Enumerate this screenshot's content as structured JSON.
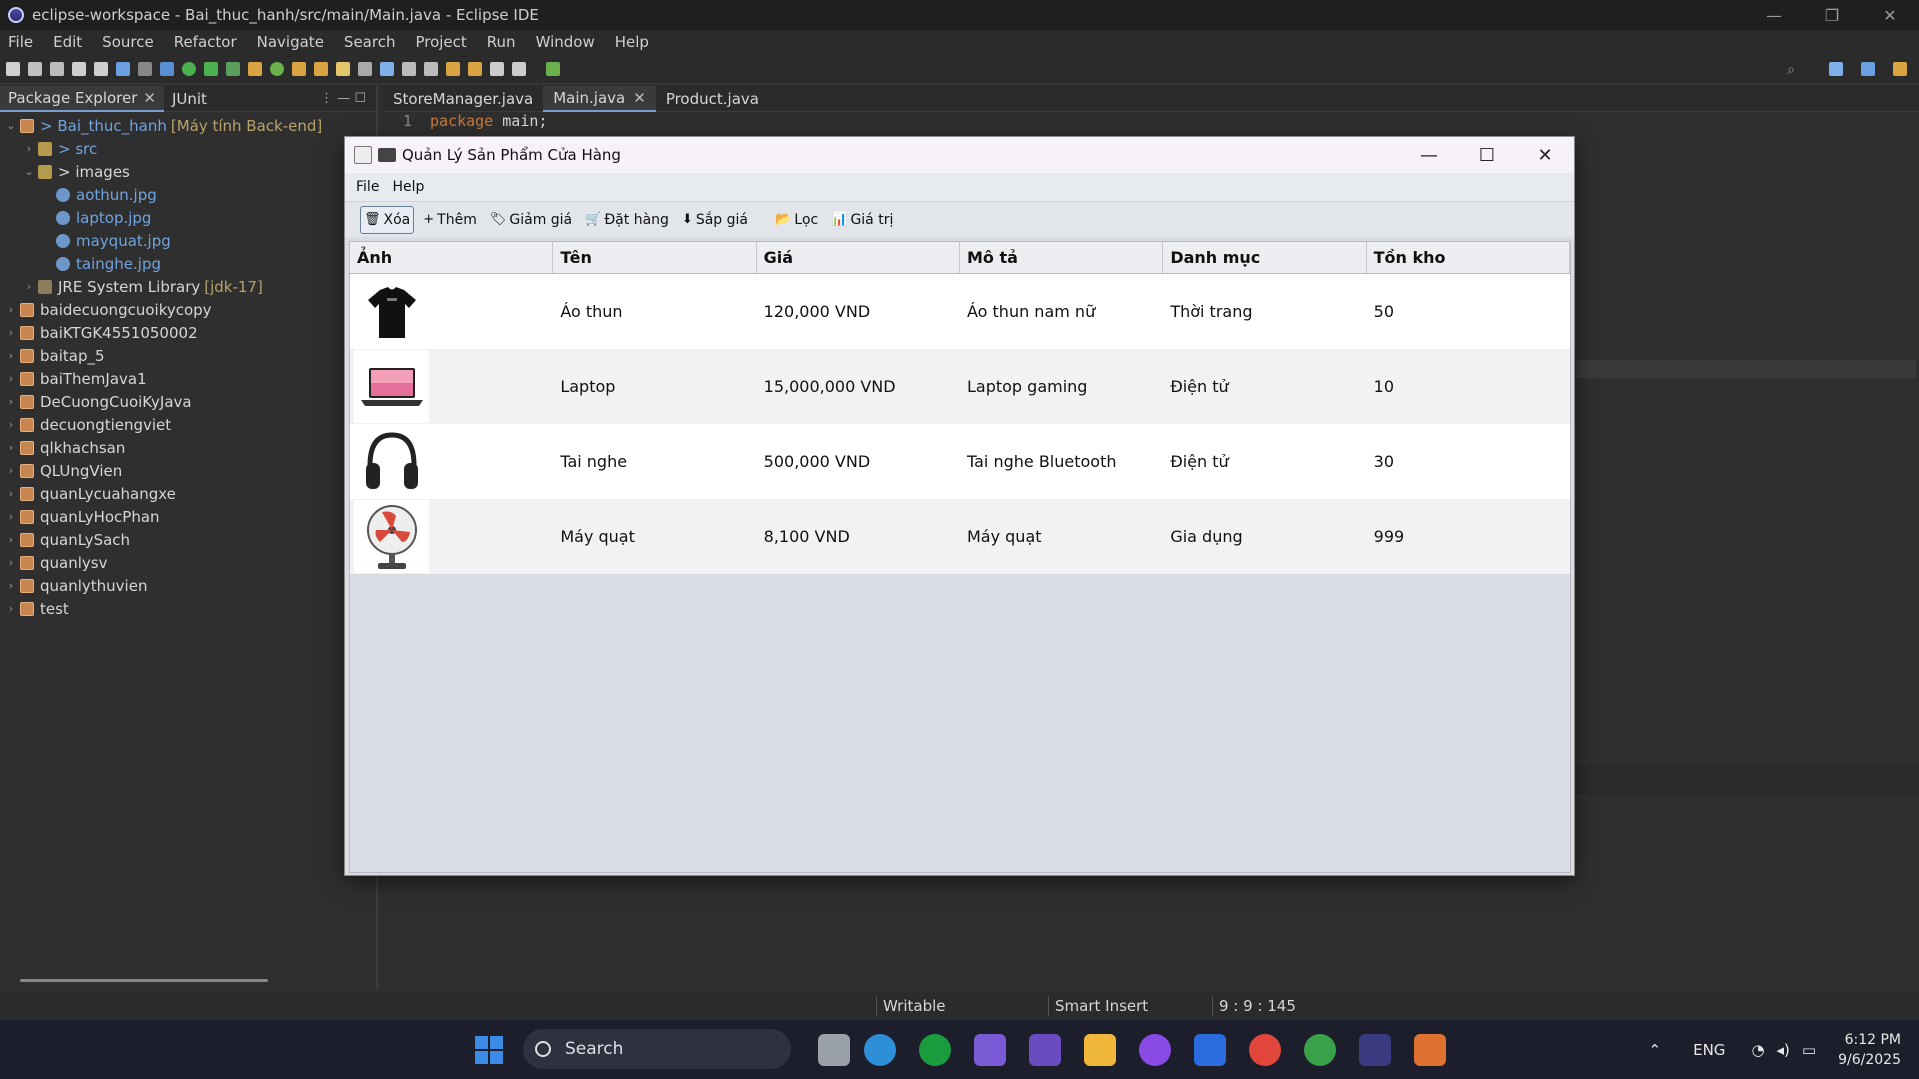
{
  "ide": {
    "title": "eclipse-workspace - Bai_thuc_hanh/src/main/Main.java - Eclipse IDE",
    "menu": [
      "File",
      "Edit",
      "Source",
      "Refactor",
      "Navigate",
      "Search",
      "Project",
      "Run",
      "Window",
      "Help"
    ],
    "explorer_tabs": [
      {
        "label": "Package Explorer",
        "active": true
      },
      {
        "label": "JUnit",
        "active": false
      }
    ],
    "tree": [
      {
        "arrow": "⌄",
        "indent": 0,
        "icon": "project-icon",
        "label": "> Bai_thuc_hanh",
        "suffix": "[Máy tính Back-end]",
        "style": "link"
      },
      {
        "arrow": "›",
        "indent": 1,
        "icon": "folder-icon",
        "label": "> src",
        "suffix": "",
        "style": "link"
      },
      {
        "arrow": "⌄",
        "indent": 1,
        "icon": "folder-icon",
        "label": "> images",
        "suffix": "",
        "style": ""
      },
      {
        "arrow": "",
        "indent": 2,
        "icon": "file-icon",
        "label": "aothun.jpg",
        "suffix": "",
        "style": "link"
      },
      {
        "arrow": "",
        "indent": 2,
        "icon": "file-icon",
        "label": "laptop.jpg",
        "suffix": "",
        "style": "link"
      },
      {
        "arrow": "",
        "indent": 2,
        "icon": "file-icon",
        "label": "mayquat.jpg",
        "suffix": "",
        "style": "link"
      },
      {
        "arrow": "",
        "indent": 2,
        "icon": "file-icon",
        "label": "tainghe.jpg",
        "suffix": "",
        "style": "link"
      },
      {
        "arrow": "›",
        "indent": 1,
        "icon": "library-icon",
        "label": "JRE System Library",
        "suffix": "[jdk-17]",
        "style": ""
      },
      {
        "arrow": "›",
        "indent": 0,
        "icon": "project-icon",
        "label": "baidecuongcuoikycopy",
        "suffix": "",
        "style": ""
      },
      {
        "arrow": "›",
        "indent": 0,
        "icon": "project-icon",
        "label": "baiKTGK4551050002",
        "suffix": "",
        "style": ""
      },
      {
        "arrow": "›",
        "indent": 0,
        "icon": "project-icon",
        "label": "baitap_5",
        "suffix": "",
        "style": ""
      },
      {
        "arrow": "›",
        "indent": 0,
        "icon": "project-icon",
        "label": "baiThemJava1",
        "suffix": "",
        "style": ""
      },
      {
        "arrow": "›",
        "indent": 0,
        "icon": "project-icon",
        "label": "DeCuongCuoiKyJava",
        "suffix": "",
        "style": ""
      },
      {
        "arrow": "›",
        "indent": 0,
        "icon": "project-icon",
        "label": "decuongtiengviet",
        "suffix": "",
        "style": ""
      },
      {
        "arrow": "›",
        "indent": 0,
        "icon": "project-icon",
        "label": "qlkhachsan",
        "suffix": "",
        "style": ""
      },
      {
        "arrow": "›",
        "indent": 0,
        "icon": "project-icon",
        "label": "QLUngVien",
        "suffix": "",
        "style": ""
      },
      {
        "arrow": "›",
        "indent": 0,
        "icon": "project-icon",
        "label": "quanLycuahangxe",
        "suffix": "",
        "style": ""
      },
      {
        "arrow": "›",
        "indent": 0,
        "icon": "project-icon",
        "label": "quanLyHocPhan",
        "suffix": "",
        "style": ""
      },
      {
        "arrow": "›",
        "indent": 0,
        "icon": "project-icon",
        "label": "quanLySach",
        "suffix": "",
        "style": ""
      },
      {
        "arrow": "›",
        "indent": 0,
        "icon": "project-icon",
        "label": "quanlysv",
        "suffix": "",
        "style": ""
      },
      {
        "arrow": "›",
        "indent": 0,
        "icon": "project-icon",
        "label": "quanlythuvien",
        "suffix": "",
        "style": ""
      },
      {
        "arrow": "›",
        "indent": 0,
        "icon": "project-icon",
        "label": "test",
        "suffix": "",
        "style": ""
      }
    ],
    "editor_tabs": [
      {
        "label": "StoreManager.java",
        "active": false
      },
      {
        "label": "Main.java",
        "active": true
      },
      {
        "label": "Product.java",
        "active": false
      }
    ],
    "code": {
      "line_no": "1",
      "keyword": "package",
      "rest": " main;"
    },
    "status": {
      "writable": "Writable",
      "insert_mode": "Smart Insert",
      "position": "9 : 9 : 145"
    }
  },
  "dialog": {
    "title": "Quản Lý Sản Phẩm Cửa Hàng",
    "menu": [
      "File",
      "Help"
    ],
    "toolbar": [
      {
        "icon": "trash-icon",
        "glyph": "🗑",
        "label": "Xóa",
        "focused": true
      },
      {
        "icon": "plus-icon",
        "glyph": "+",
        "label": "Thêm",
        "focused": false
      },
      {
        "icon": "tag-icon",
        "glyph": "🏷",
        "label": "Giảm giá",
        "focused": false
      },
      {
        "icon": "cart-icon",
        "glyph": "🛒",
        "label": "Đặt hàng",
        "focused": false
      },
      {
        "icon": "sort-icon",
        "glyph": "⬇",
        "label": "Sắp giá",
        "focused": false
      },
      {
        "icon": "folder-icon",
        "glyph": "📂",
        "label": "Lọc",
        "focused": false
      },
      {
        "icon": "chart-icon",
        "glyph": "📊",
        "label": "Giá trị",
        "focused": false
      }
    ],
    "columns": [
      "Ảnh",
      "Tên",
      "Giá",
      "Mô tả",
      "Danh mục",
      "Tồn kho"
    ],
    "rows": [
      {
        "image": "tshirt-image",
        "name": "Áo thun",
        "price": "120,000 VND",
        "desc": "Áo thun nam nữ",
        "category": "Thời trang",
        "stock": "50"
      },
      {
        "image": "laptop-image",
        "name": "Laptop",
        "price": "15,000,000 VND",
        "desc": "Laptop gaming",
        "category": "Điện tử",
        "stock": "10"
      },
      {
        "image": "headphones-image",
        "name": "Tai nghe",
        "price": "500,000 VND",
        "desc": "Tai nghe Bluetooth",
        "category": "Điện tử",
        "stock": "30"
      },
      {
        "image": "fan-image",
        "name": "Máy quạt",
        "price": "8,100 VND",
        "desc": "Máy quạt",
        "category": "Gia dụng",
        "stock": "999"
      }
    ]
  },
  "taskbar": {
    "search_placeholder": "Search",
    "language": "ENG",
    "time": "6:12 PM",
    "date": "9/6/2025"
  }
}
